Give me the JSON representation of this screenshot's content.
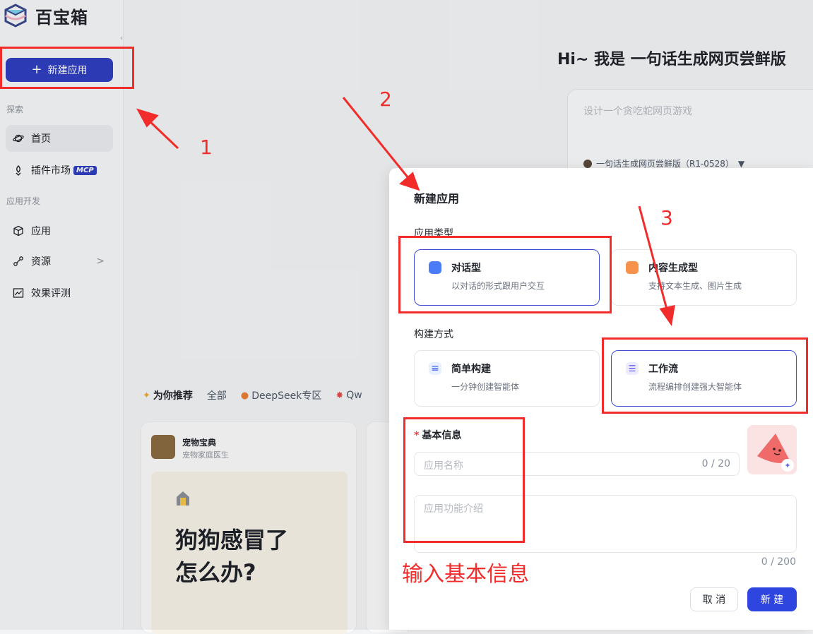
{
  "logo": {
    "text": "百宝箱"
  },
  "sidebar": {
    "new_app_label": "新建应用",
    "section_explore": "探索",
    "explore_items": [
      {
        "label": "首页",
        "icon": "planet-icon",
        "active": true
      },
      {
        "label": "插件市场",
        "icon": "plugin-icon",
        "badge": "MCP"
      }
    ],
    "section_dev": "应用开发",
    "dev_items": [
      {
        "label": "应用",
        "icon": "cube-icon"
      },
      {
        "label": "资源",
        "icon": "resource-icon",
        "has_chevron": true
      },
      {
        "label": "效果评测",
        "icon": "chart-icon"
      }
    ]
  },
  "main": {
    "hero_title": "Hi~ 我是 一句话生成网页尝鲜版",
    "prompt_placeholder": "设计一个贪吃蛇网页游戏",
    "model_label": "一句话生成网页尝鲜版（R1-0528）",
    "tabs": [
      {
        "label": "为你推荐",
        "icon": "sparkle-icon",
        "active": true
      },
      {
        "label": "全部"
      },
      {
        "label": "DeepSeek专区",
        "icon": "fire-icon"
      },
      {
        "label": "Qw",
        "icon": "burst-icon"
      }
    ],
    "card": {
      "name": "宠物宝典",
      "desc": "宠物家庭医生",
      "preview_line1": "狗狗感冒了",
      "preview_line2": "怎么办?"
    }
  },
  "dialog": {
    "title": "新建应用",
    "app_type_label": "应用类型",
    "app_types": [
      {
        "title": "对话型",
        "desc": "以对话的形式跟用户交互",
        "selected": true,
        "color": "#4a7cf7"
      },
      {
        "title": "内容生成型",
        "desc": "支持文本生成、图片生成",
        "selected": false,
        "color": "#f7924a"
      }
    ],
    "build_label": "构建方式",
    "build_methods": [
      {
        "title": "简单构建",
        "desc": "一分钟创建智能体",
        "selected": false
      },
      {
        "title": "工作流",
        "desc": "流程编排创建强大智能体",
        "selected": true
      }
    ],
    "basic_info_label": "基本信息",
    "name_placeholder": "应用名称",
    "name_counter": "0 / 20",
    "desc_placeholder": "应用功能介绍",
    "desc_counter": "0 / 200",
    "cancel_label": "取 消",
    "create_label": "新 建"
  },
  "annotations": {
    "step1": "1",
    "step2": "2",
    "step3": "3",
    "note": "输入基本信息",
    "color": "#f22b2b"
  }
}
